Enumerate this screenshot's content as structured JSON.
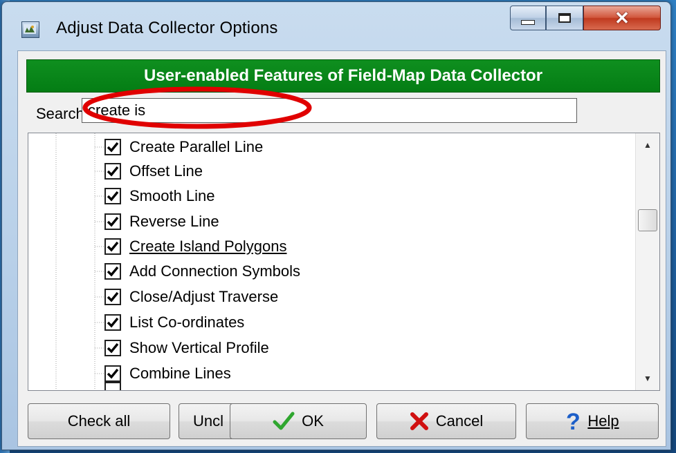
{
  "window": {
    "title": "Adjust Data Collector Options"
  },
  "header": {
    "title": "User-enabled Features of Field-Map Data Collector"
  },
  "search": {
    "label": "Search:",
    "value": "create is"
  },
  "tree": {
    "items": [
      {
        "label": "Create Parallel Line",
        "checked": true,
        "link": false
      },
      {
        "label": "Offset Line",
        "checked": true,
        "link": false
      },
      {
        "label": "Smooth Line",
        "checked": true,
        "link": false
      },
      {
        "label": "Reverse Line",
        "checked": true,
        "link": false
      },
      {
        "label": "Create Island Polygons",
        "checked": true,
        "link": true
      },
      {
        "label": "Add Connection Symbols",
        "checked": true,
        "link": false
      },
      {
        "label": "Close/Adjust Traverse",
        "checked": true,
        "link": false
      },
      {
        "label": "List Co-ordinates",
        "checked": true,
        "link": false
      },
      {
        "label": "Show Vertical Profile",
        "checked": true,
        "link": false
      },
      {
        "label": "Combine Lines",
        "checked": true,
        "link": false
      }
    ]
  },
  "buttons": {
    "check_all": "Check all",
    "uncheck_all": "Uncl",
    "ok": "OK",
    "cancel": "Cancel",
    "help": "Help"
  },
  "colors": {
    "header_bg": "#047d14",
    "highlight": "#e00000",
    "ok_icon": "#2fa62f",
    "cancel_icon": "#d01010",
    "help_icon": "#1d5fc8"
  },
  "icons": [
    "app-icon",
    "minimize-icon",
    "maximize-icon",
    "close-icon",
    "checkmark-icon",
    "ok-check-icon",
    "cancel-x-icon",
    "help-question-icon"
  ]
}
